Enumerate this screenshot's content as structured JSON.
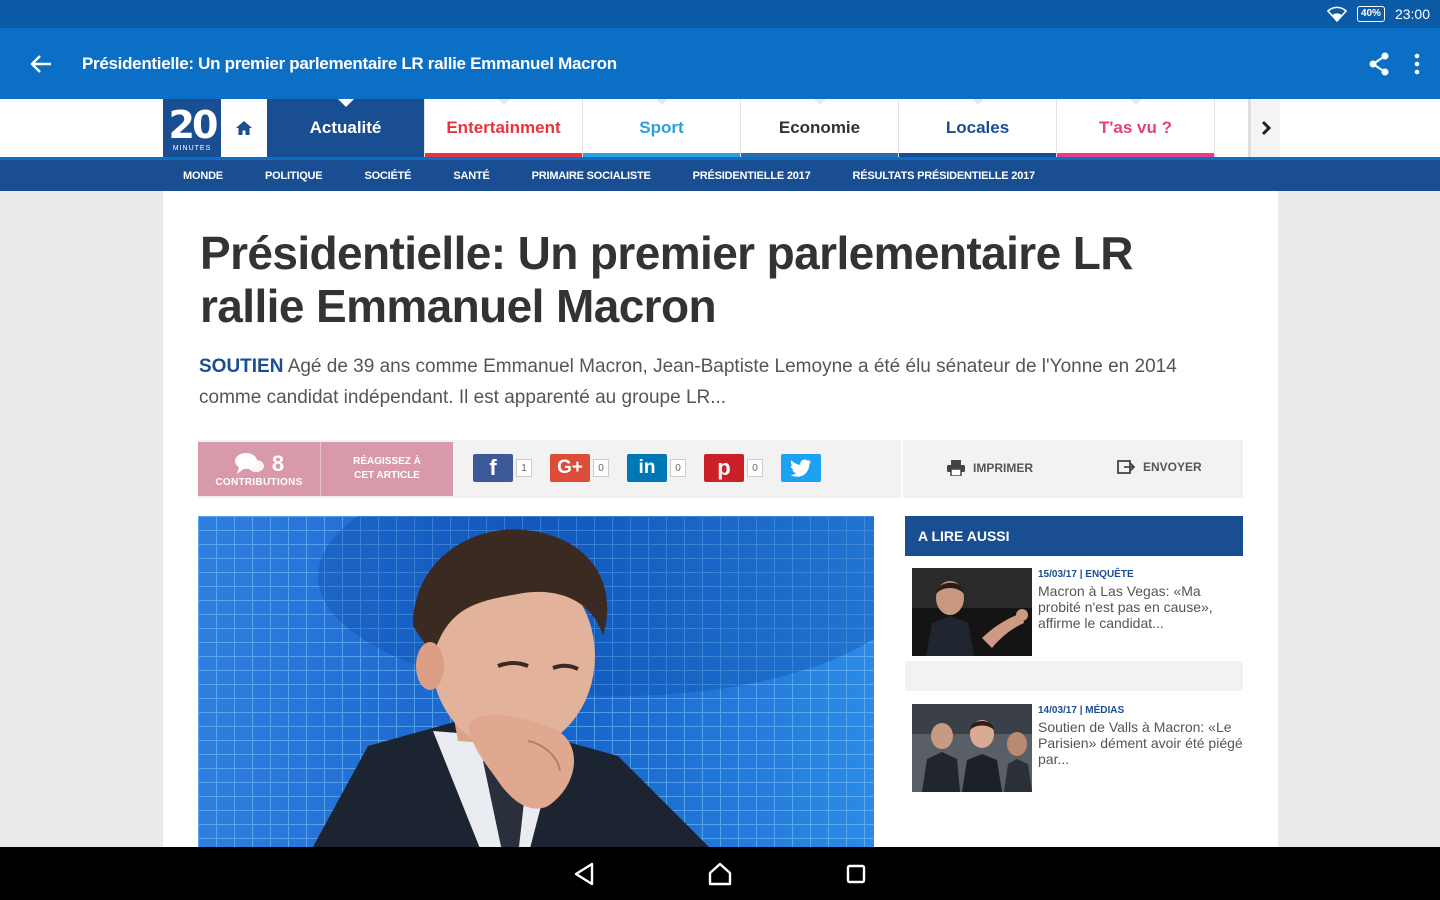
{
  "status_bar": {
    "battery": "40%",
    "time": "23:00"
  },
  "app_bar": {
    "title": "Présidentielle: Un premier parlementaire LR rallie Emmanuel Macron"
  },
  "logo": {
    "number": "20",
    "subtitle": "MINUTES"
  },
  "tabs": [
    {
      "label": "Actualité",
      "color": "#ffffff",
      "accent": "#1a4e93"
    },
    {
      "label": "Entertainment",
      "color": "#e8343f",
      "accent": "#e8343f"
    },
    {
      "label": "Sport",
      "color": "#2aa0e0",
      "accent": "#2aa0e0"
    },
    {
      "label": "Economie",
      "color": "#333333",
      "accent": "#2b6cb0"
    },
    {
      "label": "Locales",
      "color": "#1a4e93",
      "accent": "#1a4e93"
    },
    {
      "label": "T'as vu ?",
      "color": "#e63e7f",
      "accent": "#e63e7f"
    }
  ],
  "subnav": [
    "MONDE",
    "POLITIQUE",
    "SOCIÉTÉ",
    "SANTÉ",
    "PRIMAIRE SOCIALISTE",
    "PRÉSIDENTIELLE 2017",
    "RÉSULTATS PRÉSIDENTIELLE 2017"
  ],
  "article": {
    "headline": "Présidentielle: Un premier parlementaire LR rallie Emmanuel Macron",
    "kicker": "SOUTIEN",
    "lead": "Agé de 39 ans comme Emmanuel Macron, Jean-Baptiste Lemoyne a été élu sénateur de l'Yonne en 2014 comme candidat indépendant. Il est apparenté au groupe LR..."
  },
  "share": {
    "contributions_count": "8",
    "contributions_label": "CONTRIBUTIONS",
    "react_label_1": "RÉAGISSEZ À",
    "react_label_2": "CET ARTICLE",
    "facebook_count": "1",
    "google_count": "0",
    "linkedin_count": "0",
    "pinterest_count": "0",
    "print_label": "IMPRIMER",
    "send_label": "ENVOYER"
  },
  "sidebar": {
    "title": "A LIRE AUSSI",
    "items": [
      {
        "meta": "15/03/17 | ENQUÊTE",
        "text": "Macron à Las Vegas: «Ma probité n'est pas en cause», affirme le candidat..."
      },
      {
        "meta": "14/03/17 | MÉDIAS",
        "text": "Soutien de Valls à Macron: «Le Parisien» dément avoir été piégé par..."
      }
    ]
  },
  "colors": {
    "primary": "#0b6fc6",
    "navy": "#1a4e93",
    "status": "#0a5aa6",
    "pink": "#d89aab"
  }
}
